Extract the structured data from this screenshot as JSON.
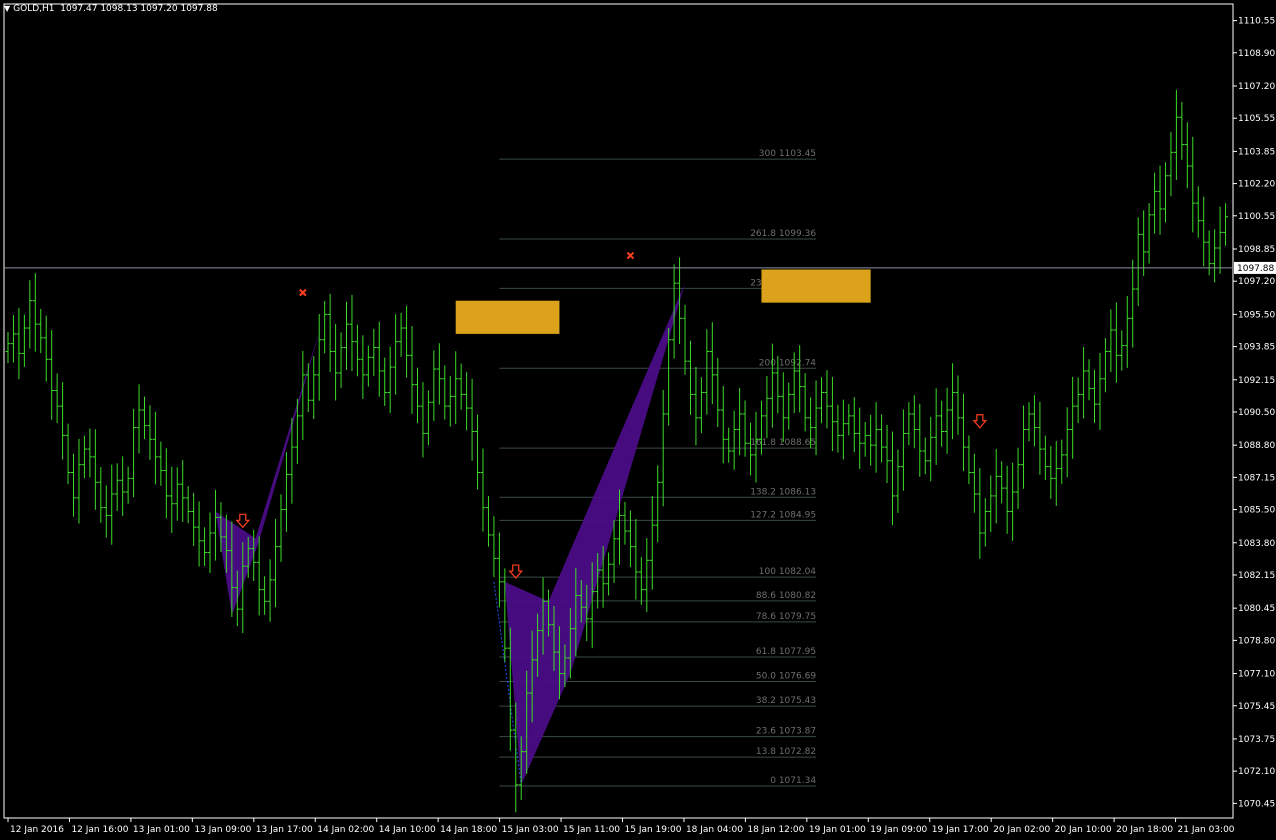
{
  "header": {
    "symbol": "GOLD,H1",
    "ohlc": "1097.47 1098.13 1097.20 1097.88"
  },
  "colors": {
    "background": "#000000",
    "bars": "#3cdc28",
    "axis": "#ffffff",
    "fib_lines": "#3a4a4a",
    "fib_labels": "#6e6e6e",
    "pattern_fill": "#4b0c87",
    "zone_fill": "#dca21c",
    "markers": "#ff4020",
    "price_line": "#8c95a2"
  },
  "icons": {
    "dropdown": "triangle-down-icon",
    "sell_arrow": "arrow-down-icon",
    "cross": "cross-icon"
  },
  "chart_data": {
    "type": "ohlc",
    "symbol": "GOLD",
    "timeframe": "H1",
    "y_range": [
      1069.7,
      1111.4
    ],
    "price_ticks": [
      "1110.55",
      "1108.90",
      "1107.20",
      "1105.55",
      "1103.85",
      "1102.20",
      "1100.55",
      "1098.85",
      "1097.20",
      "1095.50",
      "1093.85",
      "1092.15",
      "1090.50",
      "1088.80",
      "1087.15",
      "1085.50",
      "1083.80",
      "1082.15",
      "1080.45",
      "1078.80",
      "1077.10",
      "1075.45",
      "1073.75",
      "1072.10",
      "1070.45"
    ],
    "time_labels": [
      "12 Jan 2016",
      "12 Jan 16:00",
      "13 Jan 01:00",
      "13 Jan 09:00",
      "13 Jan 17:00",
      "14 Jan 02:00",
      "14 Jan 10:00",
      "14 Jan 18:00",
      "15 Jan 03:00",
      "15 Jan 11:00",
      "15 Jan 19:00",
      "18 Jan 04:00",
      "18 Jan 12:00",
      "19 Jan 01:00",
      "19 Jan 09:00",
      "19 Jan 17:00",
      "20 Jan 02:00",
      "20 Jan 10:00",
      "20 Jan 18:00",
      "21 Jan 03:00"
    ],
    "current_price": "1097.88",
    "fib_levels": [
      {
        "label": "300 1103.45",
        "price": 1103.45
      },
      {
        "label": "261.8 1099.36",
        "price": 1099.36
      },
      {
        "label": "238.2 1096.83",
        "price": 1096.83
      },
      {
        "label": "200 1092.74",
        "price": 1092.74
      },
      {
        "label": "161.8 1088.65",
        "price": 1088.65
      },
      {
        "label": "138.2 1086.13",
        "price": 1086.13
      },
      {
        "label": "127.2 1084.95",
        "price": 1084.95
      },
      {
        "label": "100 1082.04",
        "price": 1082.04
      },
      {
        "label": "88.6 1080.82",
        "price": 1080.82
      },
      {
        "label": "78.6 1079.75",
        "price": 1079.75
      },
      {
        "label": "61.8 1077.95",
        "price": 1077.95
      },
      {
        "label": "50.0 1076.69",
        "price": 1076.69
      },
      {
        "label": "38.2 1075.43",
        "price": 1075.43
      },
      {
        "label": "23.6 1073.87",
        "price": 1073.87
      },
      {
        "label": "13.8 1072.82",
        "price": 1072.82
      },
      {
        "label": "0 1071.34",
        "price": 1071.34
      }
    ],
    "zones": [
      {
        "name": "zone-left",
        "price_top": 1096.2,
        "price_bottom": 1094.5
      },
      {
        "name": "zone-right",
        "price_top": 1097.8,
        "price_bottom": 1096.1
      }
    ],
    "patterns": [
      {
        "name": "pattern-left",
        "points": [
          [
            1085.4,
            1
          ],
          [
            1080.1,
            1
          ],
          [
            1083.9,
            1
          ],
          [
            1095.5,
            1
          ]
        ]
      },
      {
        "name": "pattern-right",
        "points": [
          [
            1081.8,
            1
          ],
          [
            1071.4,
            1
          ],
          [
            1080.8,
            1
          ],
          [
            1077.1,
            1
          ],
          [
            1097.1,
            1
          ]
        ]
      }
    ],
    "sell_arrows": [
      1084.9,
      1082.3,
      1090.0
    ],
    "cross_markers": [
      1096.0,
      1097.9
    ],
    "closes": [
      1094.0,
      1094.5,
      1093.5,
      1094.8,
      1096.2,
      1095.0,
      1094.3,
      1093.2,
      1091.6,
      1090.8,
      1089.3,
      1087.4,
      1086.1,
      1087.8,
      1088.6,
      1088.2,
      1086.9,
      1085.6,
      1085.2,
      1086.3,
      1087.0,
      1086.4,
      1087.1,
      1089.7,
      1090.6,
      1089.8,
      1089.1,
      1088.2,
      1087.5,
      1086.2,
      1085.8,
      1086.8,
      1086.1,
      1085.4,
      1084.6,
      1083.9,
      1083.3,
      1084.3,
      1085.1,
      1084.1,
      1083.4,
      1081.5,
      1080.4,
      1082.6,
      1083.5,
      1082.8,
      1081.4,
      1080.8,
      1081.9,
      1083.6,
      1085.5,
      1087.3,
      1088.7,
      1090.3,
      1092.4,
      1091.1,
      1092.4,
      1094.2,
      1095.5,
      1093.6,
      1092.5,
      1093.8,
      1095.0,
      1094.1,
      1093.2,
      1092.4,
      1093.3,
      1093.8,
      1092.6,
      1091.5,
      1092.8,
      1094.1,
      1094.8,
      1093.4,
      1091.9,
      1090.8,
      1089.4,
      1091.0,
      1092.7,
      1092.2,
      1090.8,
      1091.3,
      1092.2,
      1091.4,
      1090.7,
      1089.5,
      1087.4,
      1085.6,
      1084.2,
      1083.0,
      1081.8,
      1078.4,
      1074.2,
      1071.4,
      1073.1,
      1076.1,
      1077.8,
      1079.3,
      1080.8,
      1079.6,
      1078.2,
      1077.1,
      1077.9,
      1079.4,
      1081.1,
      1080.5,
      1079.9,
      1081.3,
      1082.4,
      1081.7,
      1082.7,
      1084.0,
      1085.2,
      1084.4,
      1083.6,
      1082.3,
      1081.4,
      1082.9,
      1084.7,
      1086.9,
      1090.4,
      1094.2,
      1097.1,
      1095.3,
      1093.1,
      1091.4,
      1090.2,
      1091.5,
      1093.6,
      1092.4,
      1090.6,
      1089.1,
      1088.5,
      1089.6,
      1090.4,
      1088.9,
      1088.3,
      1089.1,
      1090.3,
      1091.2,
      1092.5,
      1091.3,
      1090.2,
      1091.4,
      1092.6,
      1091.8,
      1090.2,
      1089.7,
      1090.7,
      1091.5,
      1090.8,
      1090.0,
      1089.3,
      1089.9,
      1090.3,
      1089.4,
      1088.9,
      1089.3,
      1088.8,
      1089.6,
      1088.7,
      1088.0,
      1086.2,
      1087.7,
      1089.4,
      1090.4,
      1089.6,
      1088.5,
      1088.0,
      1089.2,
      1090.3,
      1089.5,
      1090.6,
      1091.5,
      1090.2,
      1088.7,
      1087.4,
      1086.3,
      1084.3,
      1085.4,
      1086.2,
      1087.2,
      1086.6,
      1085.4,
      1086.4,
      1087.8,
      1089.6,
      1090.4,
      1089.7,
      1088.6,
      1087.7,
      1087.1,
      1087.6,
      1088.3,
      1089.6,
      1090.8,
      1091.4,
      1092.6,
      1091.7,
      1090.9,
      1092.2,
      1093.6,
      1094.7,
      1093.4,
      1093.9,
      1095.3,
      1096.8,
      1099.6,
      1098.7,
      1100.6,
      1101.8,
      1100.9,
      1102.6,
      1103.8,
      1105.6,
      1104.2,
      1103.1,
      1101.2,
      1100.3,
      1099.2,
      1098.1,
      1098.9,
      1099.7,
      1100.5
    ]
  }
}
